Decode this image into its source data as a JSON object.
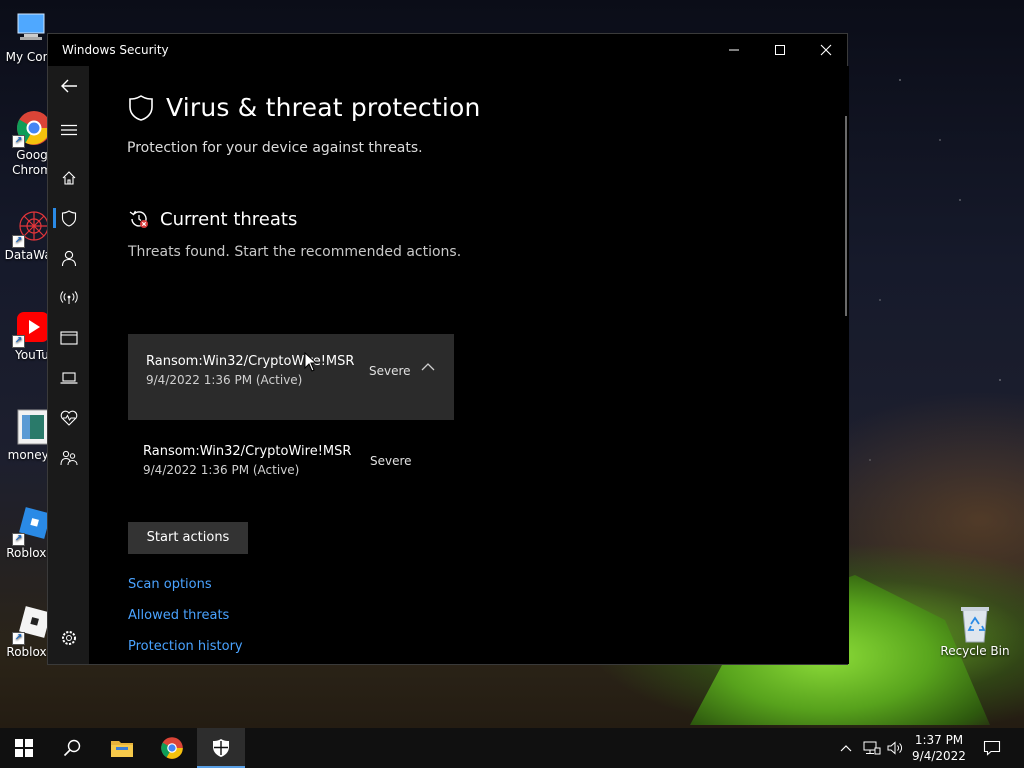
{
  "desktop": {
    "icons": [
      {
        "label": "My Com",
        "icon": "computer-icon"
      },
      {
        "label": "Goog\nChrom",
        "label1": "Goog",
        "label2": "Chrom",
        "icon": "chrome-icon"
      },
      {
        "label": "DataWag",
        "icon": "datawag-icon"
      },
      {
        "label": "YouTu",
        "icon": "youtube-icon"
      },
      {
        "label": "moneyg",
        "icon": "image-file-icon"
      },
      {
        "label": "Roblox S",
        "icon": "roblox-studio-icon"
      },
      {
        "label": "Roblox P",
        "icon": "roblox-player-icon"
      },
      {
        "label": "Recycle Bin",
        "icon": "recycle-bin-icon"
      }
    ]
  },
  "window": {
    "title": "Windows Security",
    "controls": {
      "minimize": "minimize",
      "maximize": "maximize",
      "close": "close"
    }
  },
  "nav": {
    "items": [
      {
        "name": "back",
        "icon": "back-arrow-icon"
      },
      {
        "name": "menu",
        "icon": "hamburger-menu-icon"
      },
      {
        "name": "home",
        "icon": "home-icon"
      },
      {
        "name": "virus-threat-protection",
        "icon": "shield-icon",
        "active": true
      },
      {
        "name": "account-protection",
        "icon": "person-icon"
      },
      {
        "name": "firewall-network",
        "icon": "antenna-icon"
      },
      {
        "name": "app-browser-control",
        "icon": "browser-window-icon"
      },
      {
        "name": "device-security",
        "icon": "laptop-icon"
      },
      {
        "name": "device-performance-health",
        "icon": "heart-pulse-icon"
      },
      {
        "name": "family-options",
        "icon": "family-icon"
      },
      {
        "name": "settings",
        "icon": "gear-icon"
      }
    ]
  },
  "main": {
    "title": "Virus & threat protection",
    "subtitle": "Protection for your device against threats.",
    "section": {
      "title": "Current threats",
      "description": "Threats found. Start the recommended actions."
    },
    "threats": [
      {
        "name": "Ransom:Win32/CryptoWire!MSR",
        "date": "9/4/2022 1:36 PM (Active)",
        "severity": "Severe",
        "expanded": true
      },
      {
        "name": "Ransom:Win32/CryptoWire!MSR",
        "date": "9/4/2022 1:36 PM (Active)",
        "severity": "Severe",
        "expanded": false
      }
    ],
    "start_actions": "Start actions",
    "links": {
      "scan_options": "Scan options",
      "allowed_threats": "Allowed threats",
      "protection_history": "Protection history"
    }
  },
  "taskbar": {
    "items": [
      "start-icon",
      "search-icon",
      "file-explorer-icon",
      "chrome-icon",
      "windows-security-icon"
    ],
    "clock": {
      "time": "1:37 PM",
      "date": "9/4/2022"
    }
  },
  "colors": {
    "accent": "#2a8ae6",
    "link": "#4aa3ff",
    "card_bg": "#2b2b2b",
    "nav_bg": "#1a1a1a",
    "threat_badge": "#d83b3b"
  }
}
